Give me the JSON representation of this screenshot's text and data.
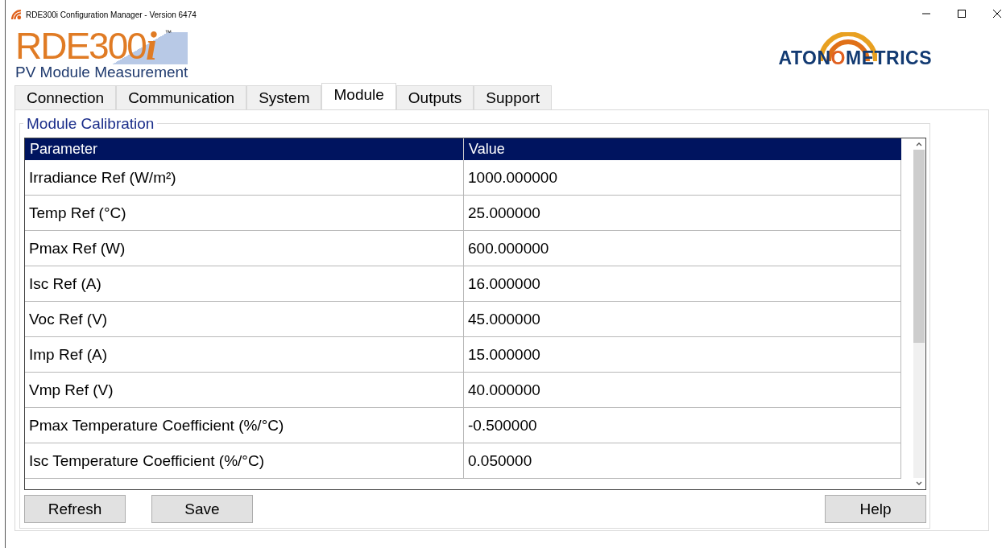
{
  "window": {
    "title": "RDE300i Configuration Manager - Version 6474"
  },
  "logo": {
    "name": "RDE300",
    "suffix": "i",
    "trademark": "™",
    "tagline": "PV Module Measurement"
  },
  "brand": {
    "before": "ATON",
    "o": "O",
    "after": "METRICS"
  },
  "tabs": [
    {
      "label": "Connection",
      "selected": false
    },
    {
      "label": "Communication",
      "selected": false
    },
    {
      "label": "System",
      "selected": false
    },
    {
      "label": "Module",
      "selected": true
    },
    {
      "label": "Outputs",
      "selected": false
    },
    {
      "label": "Support",
      "selected": false
    }
  ],
  "group": {
    "title": "Module Calibration"
  },
  "table": {
    "columns": [
      "Parameter",
      "Value"
    ],
    "rows": [
      [
        "Irradiance Ref (W/m²)",
        "1000.000000"
      ],
      [
        "Temp Ref (°C)",
        "25.000000"
      ],
      [
        "Pmax Ref (W)",
        "600.000000"
      ],
      [
        "Isc Ref (A)",
        "16.000000"
      ],
      [
        "Voc Ref (V)",
        "45.000000"
      ],
      [
        "Imp Ref (A)",
        "15.000000"
      ],
      [
        "Vmp Ref (V)",
        "40.000000"
      ],
      [
        "Pmax Temperature Coefficient (%/°C)",
        "-0.500000"
      ],
      [
        "Isc Temperature Coefficient (%/°C)",
        "0.050000"
      ]
    ]
  },
  "buttons": {
    "left": [
      "Refresh",
      "Save"
    ],
    "right": [
      "Help"
    ]
  }
}
